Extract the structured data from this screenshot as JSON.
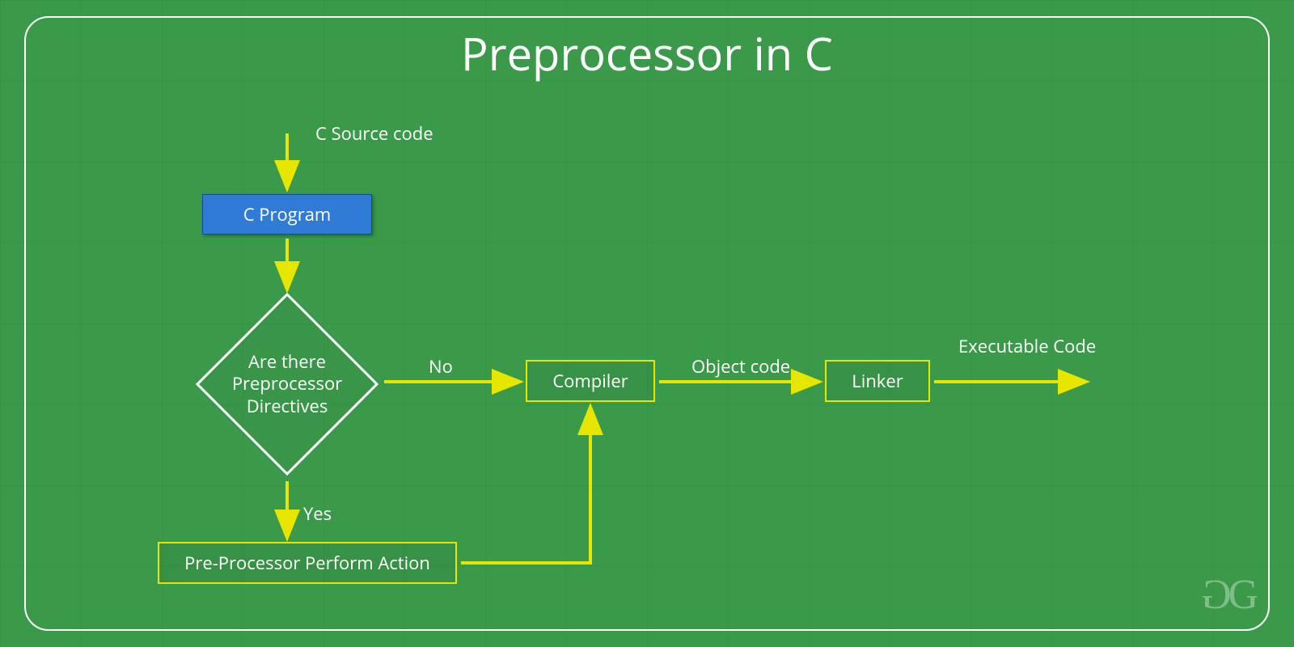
{
  "title": "Preprocessor in C",
  "nodes": {
    "source_label": "C Source code",
    "c_program": "C Program",
    "decision": "Are there Preprocessor Directives",
    "no_label": "No",
    "yes_label": "Yes",
    "preprocessor_action": "Pre-Processor Perform Action",
    "compiler": "Compiler",
    "object_code_label": "Object code",
    "linker": "Linker",
    "executable_label": "Executable Code"
  },
  "colors": {
    "background": "#3b9a4a",
    "arrow": "#e6e600",
    "node_blue": "#2f7bd6",
    "outline": "#ffffff"
  },
  "logo": "GG"
}
